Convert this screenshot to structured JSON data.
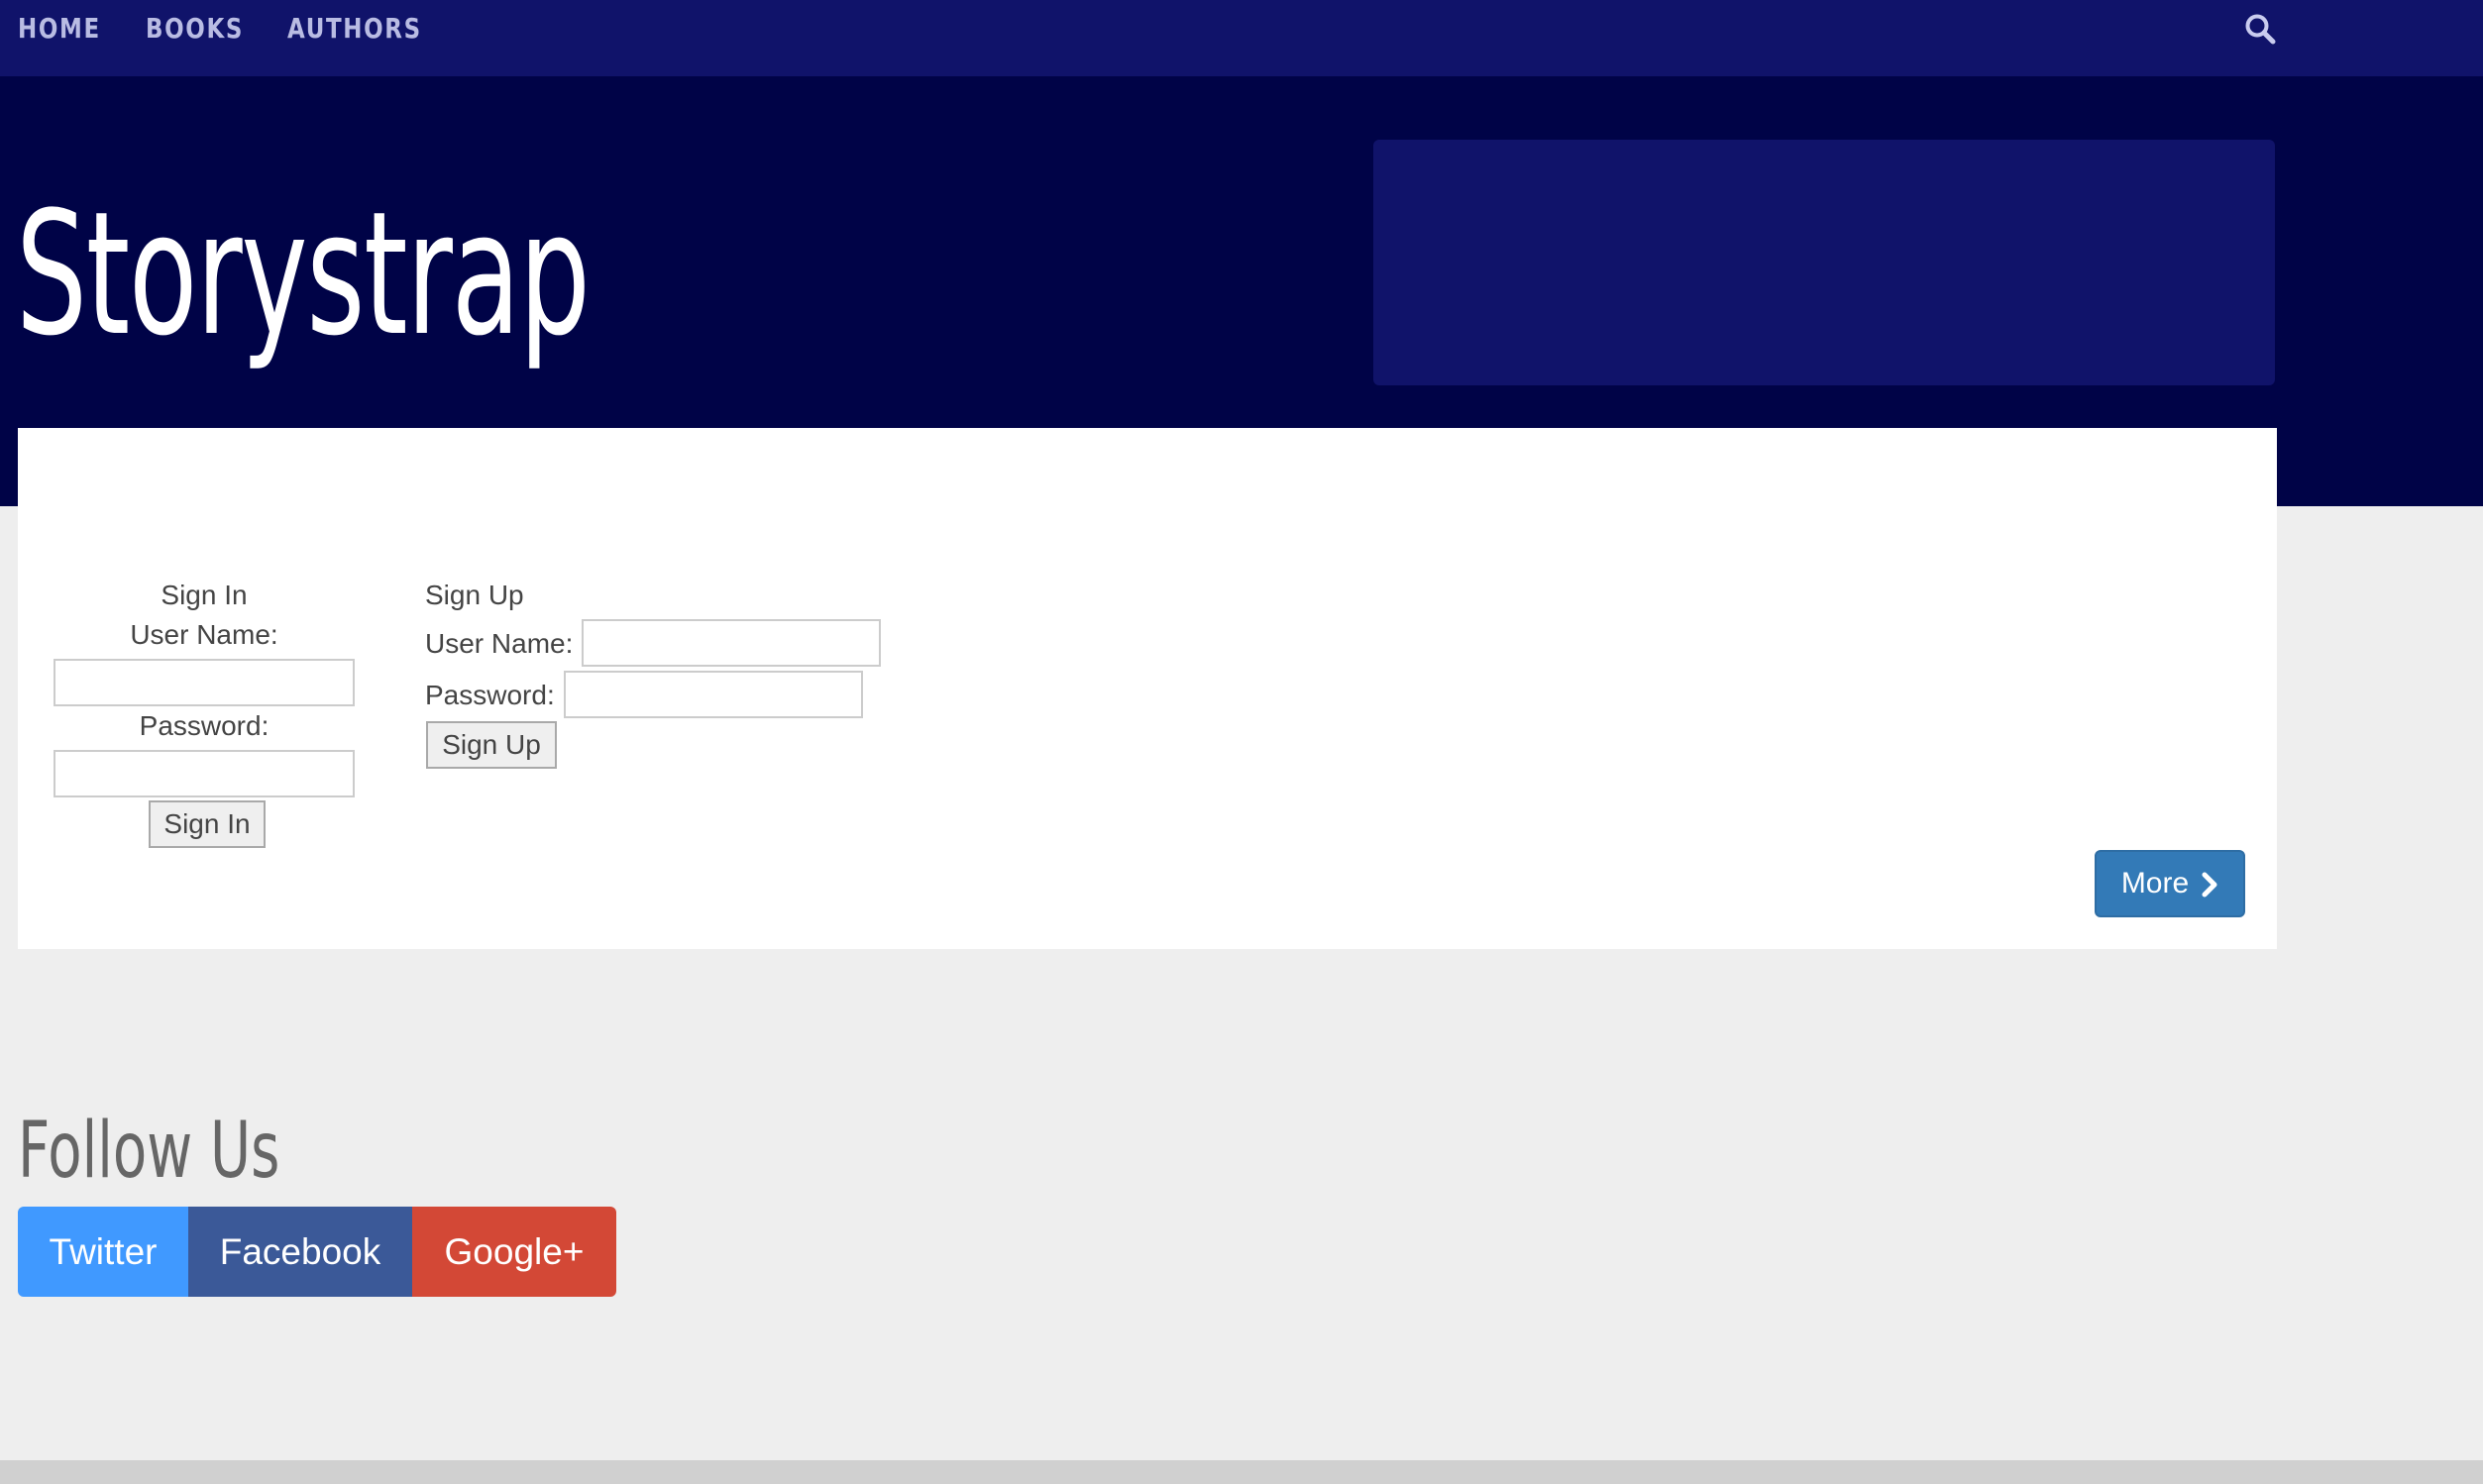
{
  "nav": {
    "items": [
      {
        "label": "HOME"
      },
      {
        "label": "BOOKS"
      },
      {
        "label": "AUTHORS"
      }
    ],
    "search_icon": "search-icon"
  },
  "hero": {
    "title": "Storystrap"
  },
  "sign_in": {
    "heading": "Sign In",
    "username_label": "User Name:",
    "username_value": "",
    "password_label": "Password:",
    "password_value": "",
    "button_label": "Sign In"
  },
  "sign_up": {
    "heading": "Sign Up",
    "username_label": "User Name:",
    "username_value": "",
    "password_label": "Password:",
    "password_value": "",
    "button_label": "Sign Up"
  },
  "more_button": {
    "label": "More",
    "icon": "chevron-right-icon"
  },
  "follow": {
    "title": "Follow Us",
    "links": [
      {
        "label": "Twitter",
        "color": "#4099ff"
      },
      {
        "label": "Facebook",
        "color": "#3b5998"
      },
      {
        "label": "Google+",
        "color": "#d34836"
      }
    ]
  },
  "colors": {
    "navbar": "#10136a",
    "hero": "#000347",
    "page_background": "#eeeeee",
    "primary_button": "#337ab7"
  }
}
